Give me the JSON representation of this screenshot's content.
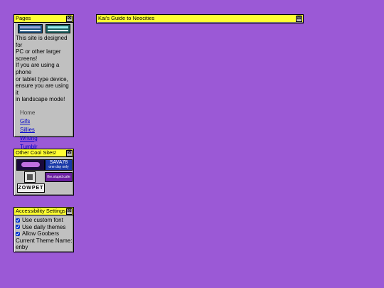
{
  "pages_window": {
    "title": "Pages",
    "close_glyph": "☒",
    "intro_lines": [
      "This site is designed for",
      "PC or other larger",
      "screens!",
      "If you are using a phone",
      "or tablet type device,",
      "ensure you are using it",
      "in landscape mode!"
    ],
    "nav": {
      "current": "Home",
      "links": [
        "Gifs",
        "Sillies",
        "Writing",
        "Tumblr"
      ]
    }
  },
  "main_window": {
    "title": "Kai's Guide to Neocities",
    "close_glyph": "☒"
  },
  "cool_sites_window": {
    "title": "Other Cool Sites!",
    "close_glyph": "☒",
    "banners": {
      "b2_line1": "SAVA78",
      "b2_line2": "one day only",
      "b4": "the.stupid.cafe",
      "b5": "ZOWPET"
    }
  },
  "accessibility_window": {
    "title": "Accessibility Settings",
    "close_glyph": "☒",
    "options": [
      {
        "label": "Use custom font",
        "checked": true
      },
      {
        "label": "Use daily themes",
        "checked": true
      },
      {
        "label": "Allow Goobers",
        "checked": true
      }
    ],
    "theme_label": "Current Theme Name:",
    "theme_value": "enby"
  },
  "colors": {
    "background": "#9b59d6",
    "titlebar": "#ffff33",
    "window": "#c0c0c0",
    "link": "#0000cc"
  }
}
